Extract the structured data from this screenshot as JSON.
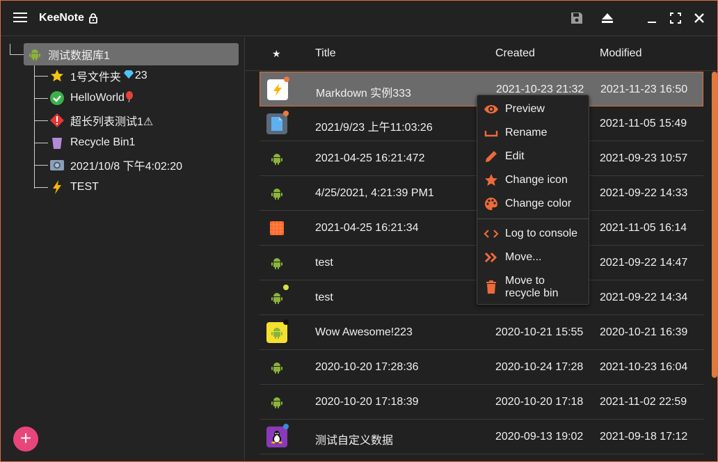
{
  "app": {
    "title": "KeeNote"
  },
  "sidebar": {
    "root": {
      "label": "测试数据库1"
    },
    "items": [
      {
        "label": "1号文件夹",
        "suffix": "23"
      },
      {
        "label": "HelloWorld"
      },
      {
        "label": "超长列表测试1⚠"
      },
      {
        "label": "Recycle Bin1"
      },
      {
        "label": "2021/10/8 下午4:02:20"
      },
      {
        "label": "TEST"
      }
    ],
    "fab_label": "+"
  },
  "table": {
    "headers": {
      "star": "★",
      "title": "Title",
      "created": "Created",
      "modified": "Modified"
    },
    "rows": [
      {
        "title": "Markdown 实例333",
        "created": "2021-10-23 21:32",
        "modified": "2021-11-23 16:50",
        "icon": "lightning-icon",
        "dot": "#f07a3a"
      },
      {
        "title": "2021/9/23 上午11:03:26",
        "created": "",
        "modified": "2021-11-05 15:49",
        "icon": "document-icon",
        "dot": "#f07a3a"
      },
      {
        "title": "2021-04-25 16:21:472",
        "created": "",
        "modified": "2021-09-23 10:57",
        "icon": "android-icon",
        "dot": ""
      },
      {
        "title": "4/25/2021, 4:21:39 PM1",
        "created": "",
        "modified": "2021-09-22 14:33",
        "icon": "android-icon",
        "dot": ""
      },
      {
        "title": "2021-04-25 16:21:34",
        "created": "",
        "modified": "2021-11-05 16:14",
        "icon": "grid-icon",
        "dot": ""
      },
      {
        "title": "test",
        "created": "",
        "modified": "2021-09-22 14:47",
        "icon": "android-icon",
        "dot": ""
      },
      {
        "title": "test",
        "created": "",
        "modified": "2021-09-22 14:34",
        "icon": "android-icon",
        "dot": "#d8e040"
      },
      {
        "title": "Wow Awesome!223",
        "created": "2020-10-21 15:55",
        "modified": "2020-10-21 16:39",
        "icon": "android-icon",
        "dot": "#111111"
      },
      {
        "title": "2020-10-20 17:28:36",
        "created": "2020-10-24 17:28",
        "modified": "2021-10-23 16:04",
        "icon": "android-icon",
        "dot": ""
      },
      {
        "title": "2020-10-20 17:18:39",
        "created": "2020-10-20 17:18",
        "modified": "2021-11-02 22:59",
        "icon": "android-icon",
        "dot": ""
      },
      {
        "title": "测试自定义数据",
        "created": "2020-09-13 19:02",
        "modified": "2021-09-18 17:12",
        "icon": "linux-icon",
        "dot": "#3a8ad8"
      }
    ]
  },
  "context_menu": {
    "items": [
      {
        "label": "Preview",
        "icon": "eye-icon"
      },
      {
        "label": "Rename",
        "icon": "rename-icon"
      },
      {
        "label": "Edit",
        "icon": "pencil-icon"
      },
      {
        "label": "Change icon",
        "icon": "star-icon"
      },
      {
        "label": "Change color",
        "icon": "palette-icon"
      },
      {
        "label": "Log to console",
        "icon": "code-icon"
      },
      {
        "label": "Move...",
        "icon": "double-chevron-icon"
      },
      {
        "label": "Move to recycle bin",
        "icon": "trash-icon"
      }
    ]
  },
  "colors": {
    "accent": "#e0703a",
    "selected_row": "#6b6b6b",
    "fab": "#e8457a",
    "android": "#8ab33a"
  }
}
